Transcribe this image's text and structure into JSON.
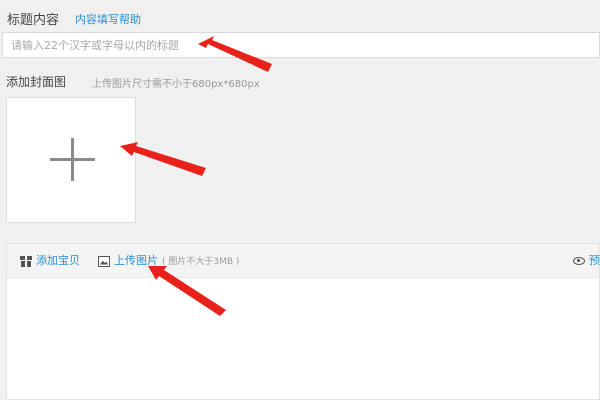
{
  "title_section": {
    "label": "标题内容",
    "help_link": "内容填写帮助",
    "input_placeholder": "请输入22个汉字或字母以内的标题",
    "input_value": ""
  },
  "cover_section": {
    "label": "添加封面图",
    "hint": "上传图片尺寸需不小于680px*680px"
  },
  "editor_toolbar": {
    "add_item_label": "添加宝贝",
    "upload_image_label": "上传图片",
    "upload_image_note": "( 图片不大于3MB )",
    "preview_label": "预"
  },
  "annotation_color": "#e8221b",
  "icons": [
    "gift-icon",
    "image-icon",
    "eye-icon",
    "plus-icon"
  ]
}
